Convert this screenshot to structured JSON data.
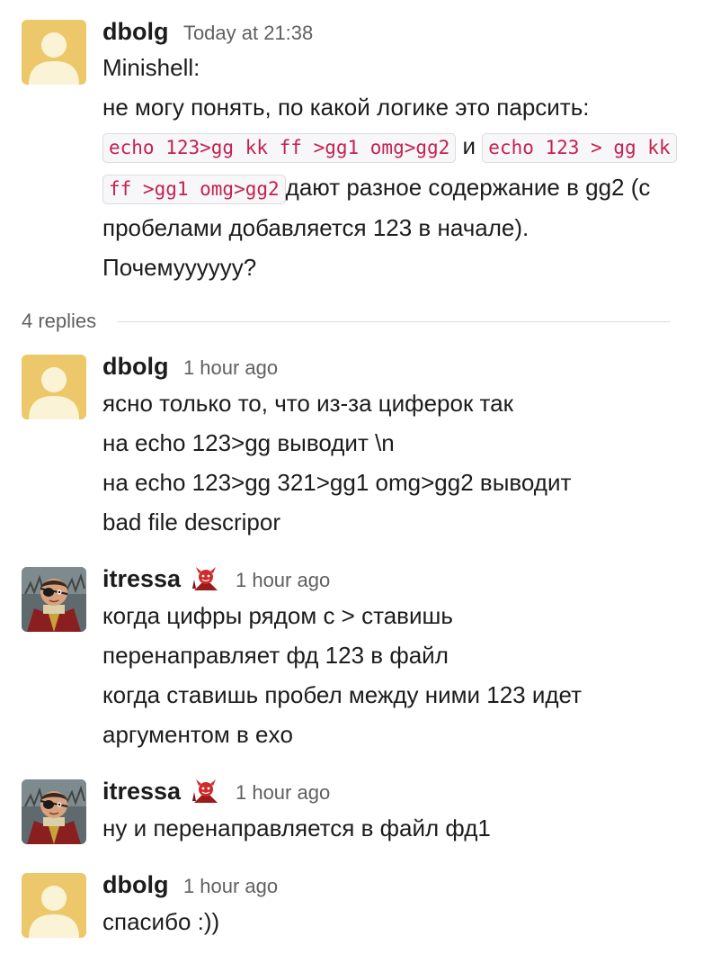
{
  "parent_message": {
    "author": "dbolg",
    "timestamp": "Today at 21:38",
    "line1": "Minishell:",
    "line2": "не могу понять, по какой логике это парсить:",
    "code1": "echo 123>gg kk ff >gg1 omg>gg2",
    "connector": "и",
    "code2": "echo 123 > gg kk ff >gg1 omg>gg2",
    "tail": "дают разное содержание в gg2 (с пробелами добавляется 123 в начале). Почемуууууу?"
  },
  "thread": {
    "replies_label": "4 replies"
  },
  "replies": [
    {
      "author": "dbolg",
      "timestamp": "1 hour ago",
      "lines": [
        "ясно только то, что из-за циферок так",
        "на echo 123>gg выводит \\n",
        "на echo 123>gg 321>gg1 omg>gg2 выводит",
        "bad file descripor"
      ]
    },
    {
      "author": "itressa",
      "timestamp": "1 hour ago",
      "status_emoji": "red-devil-emoji",
      "lines": [
        "когда цифры рядом с > ставишь",
        "перенаправляет фд 123 в файл",
        "когда ставишь пробел между ними 123 идет",
        "аргументом в exo"
      ]
    },
    {
      "author": "itressa",
      "timestamp": "1 hour ago",
      "status_emoji": "red-devil-emoji",
      "lines": [
        "ну и перенаправляется в файл фд1"
      ]
    },
    {
      "author": "dbolg",
      "timestamp": "1 hour ago",
      "lines": [
        "спасибо :))"
      ]
    }
  ],
  "colors": {
    "default_avatar_bg": "#ecc86a",
    "default_avatar_fg": "#fbf3d6",
    "code_text": "#c3224f",
    "timestamp": "#616061"
  }
}
